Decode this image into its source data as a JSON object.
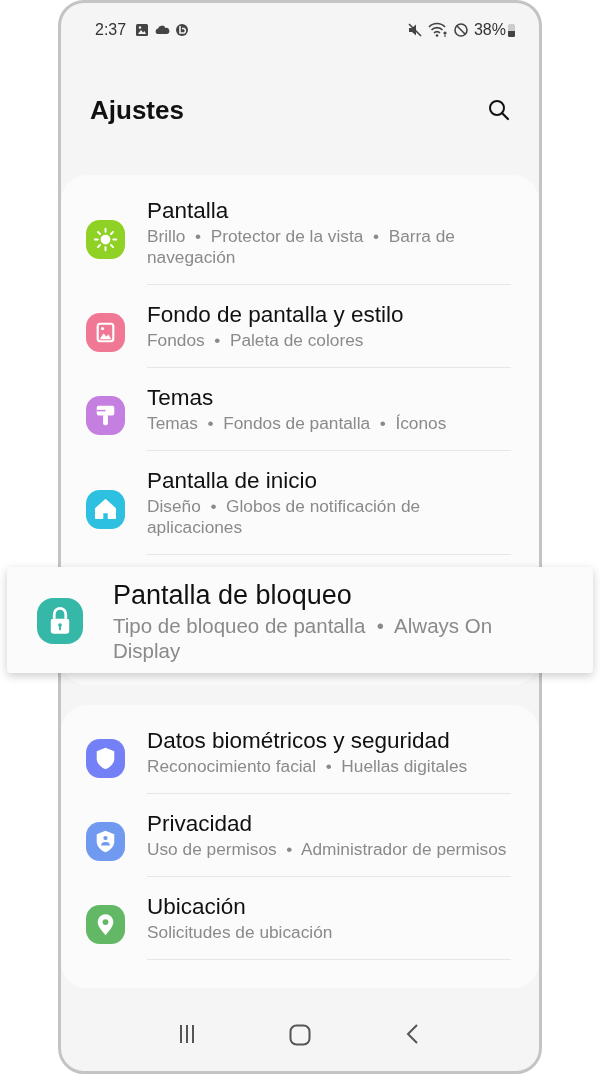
{
  "status_bar": {
    "time": "2:37",
    "battery": "38%"
  },
  "header": {
    "title": "Ajustes"
  },
  "groups": [
    {
      "items": [
        {
          "title": "Pantalla",
          "subtitle": "Brillo  •  Protector de la vista  •  Barra de navegación",
          "color": "#8fd124",
          "highlighted": false
        },
        {
          "title": "Fondo de pantalla y estilo",
          "subtitle": "Fondos  •  Paleta de colores",
          "color": "#f07895",
          "highlighted": false
        },
        {
          "title": "Temas",
          "subtitle": "Temas  •  Fondos de pantalla  •  Íconos",
          "color": "#c57fe0",
          "highlighted": false
        },
        {
          "title": "Pantalla de inicio",
          "subtitle": "Diseño  •  Globos de notificación de aplicaciones",
          "color": "#2ec0e0",
          "highlighted": false
        },
        {
          "title": "Pantalla de bloqueo",
          "subtitle": "Tipo de bloqueo de pantalla  •  Always On Display",
          "color": "#36b8a8",
          "highlighted": true
        }
      ]
    },
    {
      "items": [
        {
          "title": "Datos biométricos y seguridad",
          "subtitle": "Reconocimiento facial  •  Huellas digitales",
          "color": "#7480f5",
          "highlighted": false
        },
        {
          "title": "Privacidad",
          "subtitle": "Uso de permisos  •  Administrador de permisos",
          "color": "#6f9af0",
          "highlighted": false
        },
        {
          "title": "Ubicación",
          "subtitle": "Solicitudes de ubicación",
          "color": "#62b865",
          "highlighted": false
        }
      ]
    }
  ]
}
